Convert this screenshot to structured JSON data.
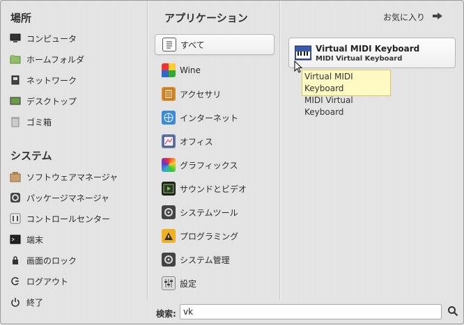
{
  "places": {
    "title": "場所",
    "items": [
      {
        "label": "コンピュータ",
        "icon": "computer-icon"
      },
      {
        "label": "ホームフォルダ",
        "icon": "home-folder-icon"
      },
      {
        "label": "ネットワーク",
        "icon": "network-icon"
      },
      {
        "label": "デスクトップ",
        "icon": "desktop-icon"
      },
      {
        "label": "ゴミ箱",
        "icon": "trash-icon"
      }
    ]
  },
  "system": {
    "title": "システム",
    "items": [
      {
        "label": "ソフトウェアマネージャ",
        "icon": "software-manager-icon"
      },
      {
        "label": "パッケージマネージャ",
        "icon": "package-manager-icon"
      },
      {
        "label": "コントロールセンター",
        "icon": "control-center-icon"
      },
      {
        "label": "端末",
        "icon": "terminal-icon"
      },
      {
        "label": "画面のロック",
        "icon": "lock-icon"
      },
      {
        "label": "ログアウト",
        "icon": "logout-icon"
      },
      {
        "label": "終了",
        "icon": "power-icon"
      }
    ]
  },
  "applications": {
    "title": "アプリケーション",
    "favorites_label": "お気に入り",
    "categories": [
      {
        "label": "すべて",
        "icon": "all-icon",
        "selected": true
      },
      {
        "label": "Wine",
        "icon": "wine-icon"
      },
      {
        "label": "アクセサリ",
        "icon": "accessories-icon"
      },
      {
        "label": "インターネット",
        "icon": "internet-icon"
      },
      {
        "label": "オフィス",
        "icon": "office-icon"
      },
      {
        "label": "グラフィックス",
        "icon": "graphics-icon"
      },
      {
        "label": "サウンドとビデオ",
        "icon": "sound-video-icon"
      },
      {
        "label": "システムツール",
        "icon": "system-tools-icon"
      },
      {
        "label": "プログラミング",
        "icon": "programming-icon"
      },
      {
        "label": "システム管理",
        "icon": "administration-icon"
      },
      {
        "label": "設定",
        "icon": "settings-icon"
      }
    ]
  },
  "results": {
    "items": [
      {
        "name": "Virtual MIDI Keyboard",
        "description": "MIDI Virtual Keyboard",
        "icon": "midi-keyboard-icon"
      }
    ],
    "tooltip": {
      "line1": "Virtual MIDI Keyboard",
      "line2": "MIDI Virtual Keyboard"
    }
  },
  "search": {
    "label": "検索:",
    "value": "vk"
  }
}
